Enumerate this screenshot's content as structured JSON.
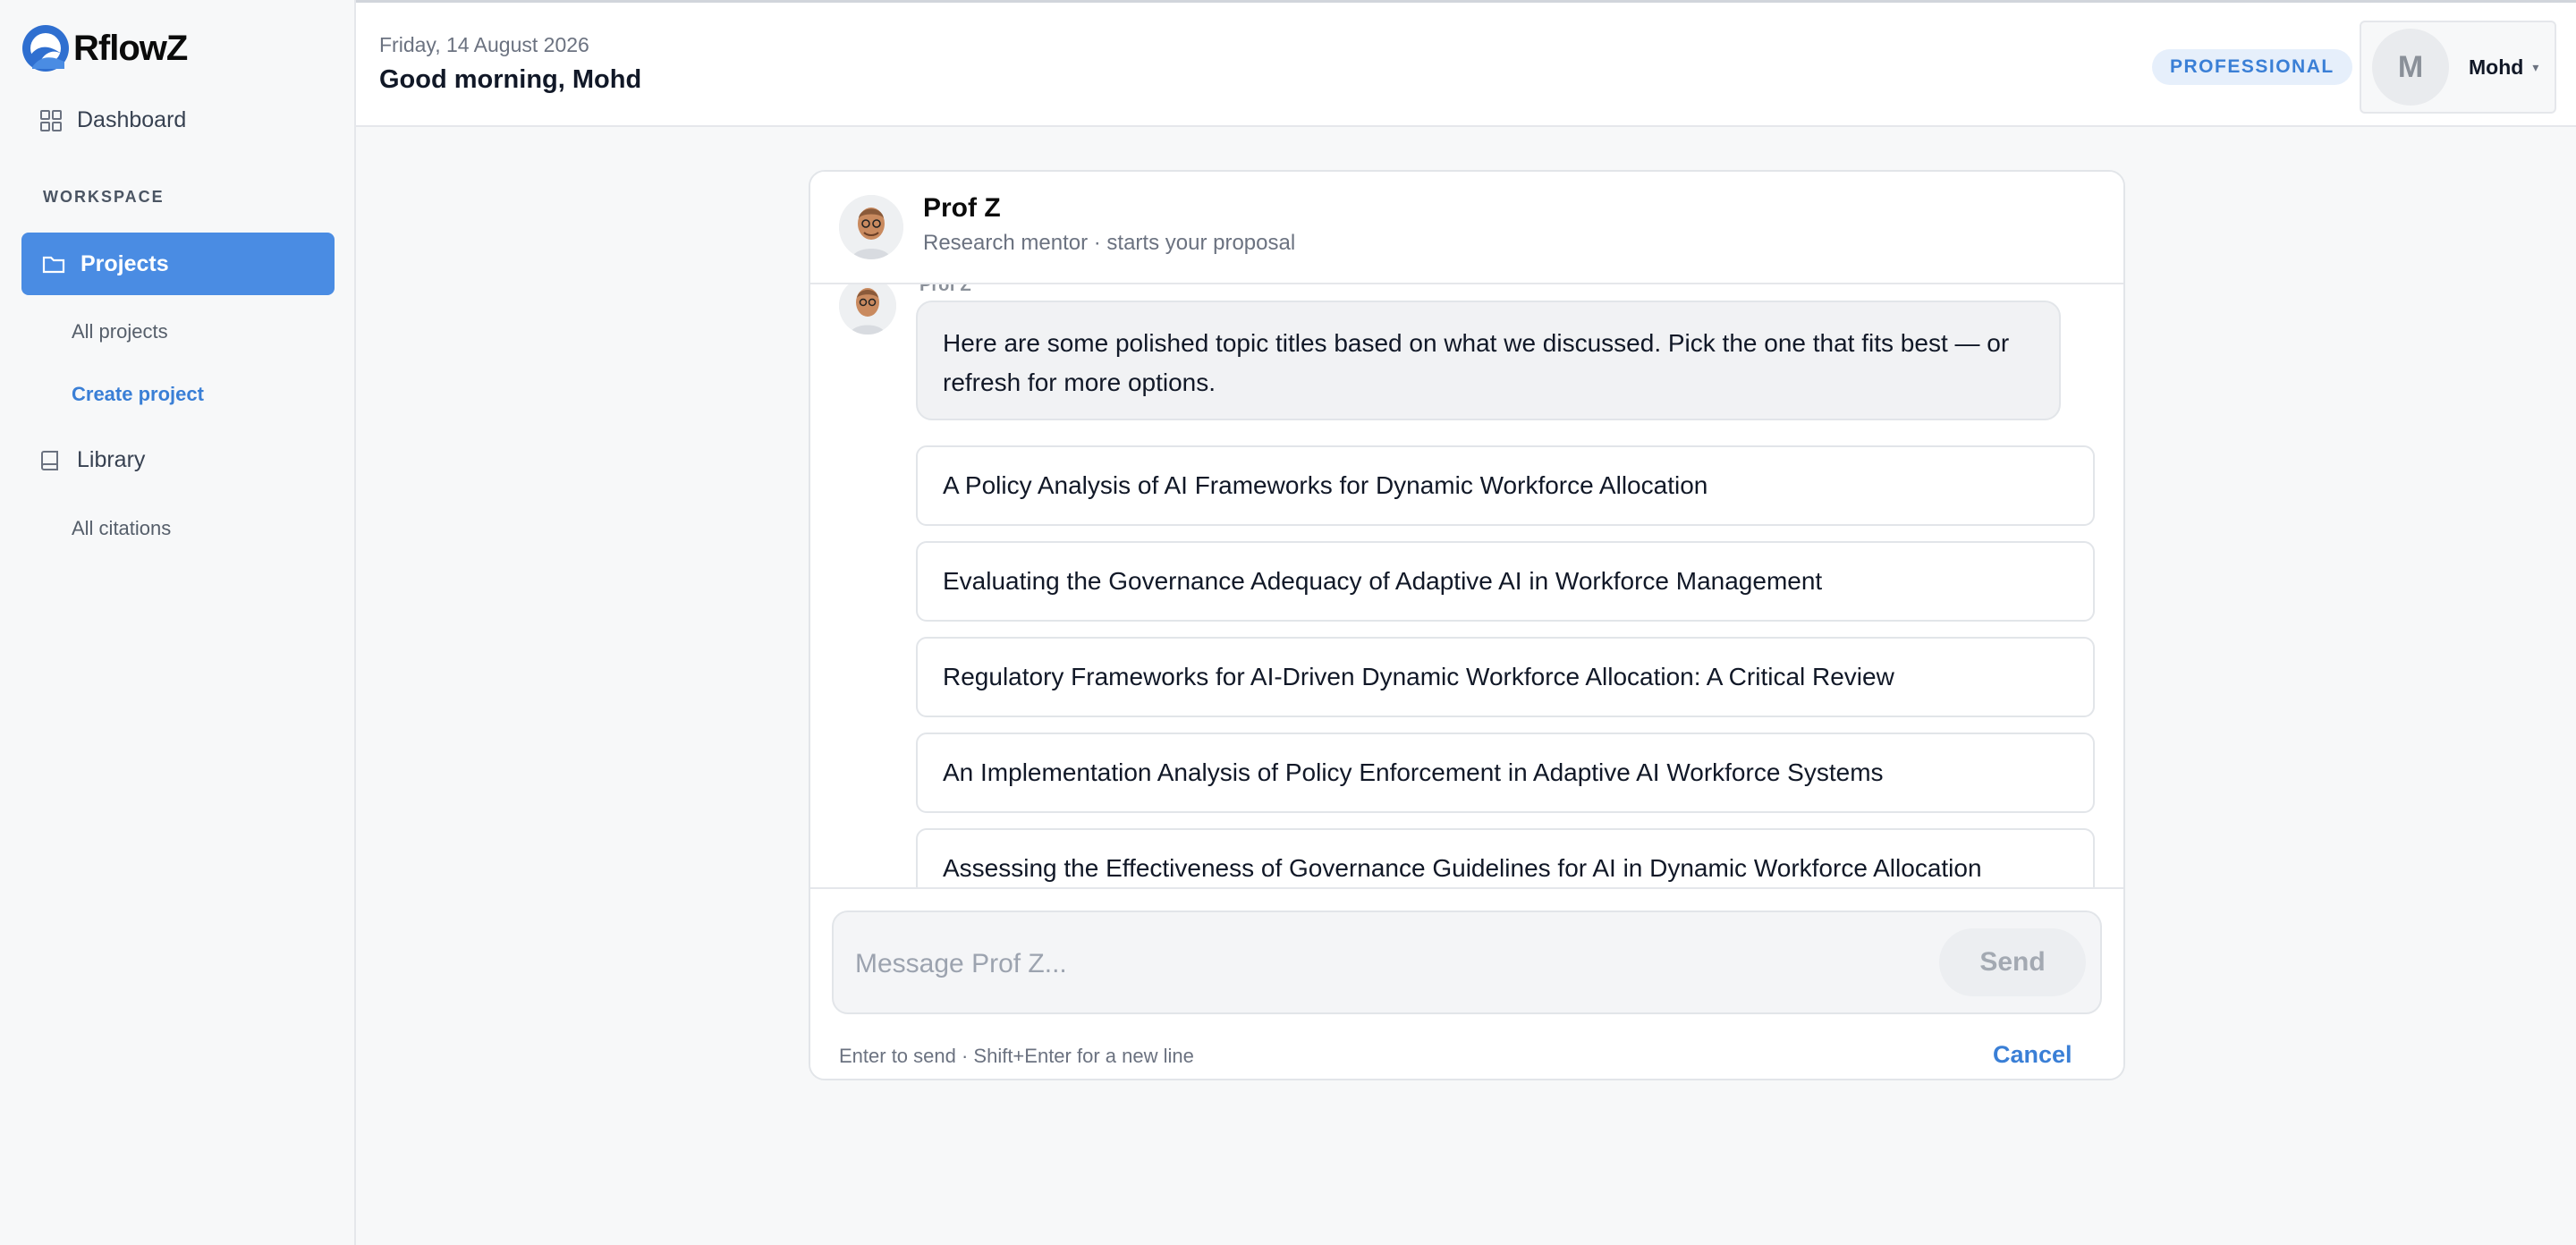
{
  "app": {
    "name": "RflowZ"
  },
  "sidebar": {
    "dashboard_label": "Dashboard",
    "section_label": "WORKSPACE",
    "projects_label": "Projects",
    "projects_sub": [
      "All projects",
      "Create project"
    ],
    "library_label": "Library",
    "library_sub": [
      "All citations"
    ]
  },
  "header": {
    "date": "Friday, 14 August 2026",
    "greeting": "Good morning, Mohd",
    "plan_badge": "PROFESSIONAL",
    "user_initial": "M",
    "user_name": "Mohd"
  },
  "chat": {
    "mentor_name": "Prof Z",
    "mentor_subtitle": "Research mentor · starts your proposal",
    "sender": "Prof Z",
    "message": "Here are some polished topic titles based on what we discussed. Pick the one that fits best — or refresh for more options.",
    "options": [
      "A Policy Analysis of AI Frameworks for Dynamic Workforce Allocation",
      "Evaluating the Governance Adequacy of Adaptive AI in Workforce Management",
      "Regulatory Frameworks for AI-Driven Dynamic Workforce Allocation: A Critical Review",
      "An Implementation Analysis of Policy Enforcement in Adaptive AI Workforce Systems",
      "Assessing the Effectiveness of Governance Guidelines for AI in Dynamic Workforce Allocation"
    ],
    "composer_placeholder": "Message Prof Z...",
    "send_label": "Send",
    "hint": "Enter to send · Shift+Enter for a new line",
    "cancel_label": "Cancel"
  },
  "colors": {
    "accent": "#4a8ce3",
    "link": "#3a7fd6",
    "badge_bg": "#e6effb"
  }
}
